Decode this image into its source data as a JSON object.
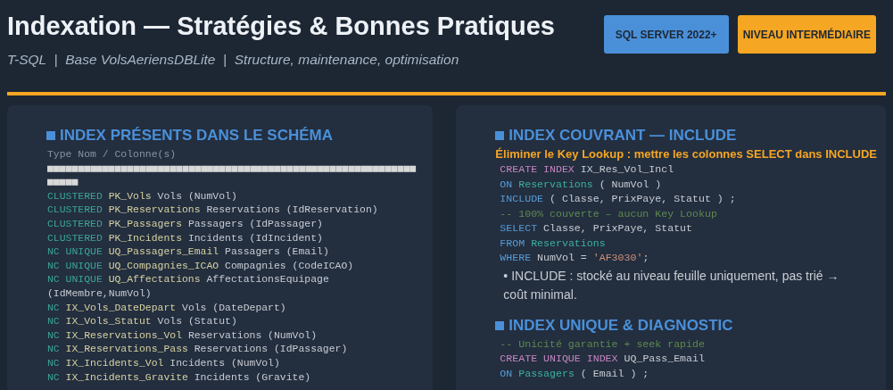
{
  "header": {
    "title": "Indexation — Stratégies & Bonnes Pratiques",
    "subtitle": "T-SQL  |  Base VolsAeriensDBLite  |  Structure, maintenance, optimisation",
    "badges": [
      {
        "label": "SQL SERVER 2022+",
        "color": "#4a90d9"
      },
      {
        "label": "NIVEAU INTERMÉDIAIRE",
        "color": "#f5a623"
      }
    ]
  },
  "cards": [
    {
      "blocks": [
        {
          "kind": "heading",
          "text": "INDEX PRÉSENTS DANS LE SCHÉMA"
        },
        {
          "kind": "caption",
          "text": "Type Nom / Colonne(s)"
        },
        {
          "kind": "rule",
          "text": "■■■■■■■■■■■■■■■■■■■■■■■■■■■■■■■■■■■■■■■■■■■■■■■■■■■■■■■■■■■■■■■■■"
        },
        {
          "kind": "code",
          "tokens": [
            {
              "kind": "type",
              "text": "CLUSTERED"
            },
            {
              "kind": "name",
              "text": " PK_Vols"
            },
            {
              "kind": "plain",
              "text": " Vols (NumVol)"
            }
          ]
        },
        {
          "kind": "code",
          "tokens": [
            {
              "kind": "type",
              "text": "CLUSTERED"
            },
            {
              "kind": "name",
              "text": " PK_Reservations"
            },
            {
              "kind": "plain",
              "text": " Reservations (IdReservation)"
            }
          ]
        },
        {
          "kind": "code",
          "tokens": [
            {
              "kind": "type",
              "text": "CLUSTERED"
            },
            {
              "kind": "name",
              "text": " PK_Passagers"
            },
            {
              "kind": "plain",
              "text": " Passagers (IdPassager)"
            }
          ]
        },
        {
          "kind": "code",
          "tokens": [
            {
              "kind": "type",
              "text": "CLUSTERED"
            },
            {
              "kind": "name",
              "text": " PK_Incidents"
            },
            {
              "kind": "plain",
              "text": " Incidents (IdIncident)"
            }
          ]
        },
        {
          "kind": "code",
          "tokens": [
            {
              "kind": "type",
              "text": "NC UNIQUE"
            },
            {
              "kind": "name",
              "text": " UQ_Passagers_Email"
            },
            {
              "kind": "plain",
              "text": " Passagers (Email)"
            }
          ]
        },
        {
          "kind": "code",
          "tokens": [
            {
              "kind": "type",
              "text": "NC UNIQUE"
            },
            {
              "kind": "name",
              "text": " UQ_Compagnies_ICAO"
            },
            {
              "kind": "plain",
              "text": " Compagnies (CodeICAO)"
            }
          ]
        },
        {
          "kind": "code",
          "tokens": [
            {
              "kind": "type",
              "text": "NC UNIQUE"
            },
            {
              "kind": "name",
              "text": " UQ_Affectations"
            },
            {
              "kind": "plain",
              "text": " AffectationsEquipage (IdMembre,NumVol)"
            }
          ]
        },
        {
          "kind": "code",
          "tokens": [
            {
              "kind": "type",
              "text": "NC"
            },
            {
              "kind": "name",
              "text": " IX_Vols_DateDepart"
            },
            {
              "kind": "plain",
              "text": " Vols (DateDepart)"
            }
          ]
        },
        {
          "kind": "code",
          "tokens": [
            {
              "kind": "type",
              "text": "NC"
            },
            {
              "kind": "name",
              "text": " IX_Vols_Statut"
            },
            {
              "kind": "plain",
              "text": " Vols (Statut)"
            }
          ]
        },
        {
          "kind": "code",
          "tokens": [
            {
              "kind": "type",
              "text": "NC"
            },
            {
              "kind": "name",
              "text": " IX_Reservations_Vol"
            },
            {
              "kind": "plain",
              "text": " Reservations (NumVol)"
            }
          ]
        },
        {
          "kind": "code",
          "tokens": [
            {
              "kind": "type",
              "text": "NC"
            },
            {
              "kind": "name",
              "text": " IX_Reservations_Pass"
            },
            {
              "kind": "plain",
              "text": " Reservations (IdPassager)"
            }
          ]
        },
        {
          "kind": "code",
          "tokens": [
            {
              "kind": "type",
              "text": "NC"
            },
            {
              "kind": "name",
              "text": " IX_Incidents_Vol"
            },
            {
              "kind": "plain",
              "text": " Incidents (NumVol)"
            }
          ]
        },
        {
          "kind": "code",
          "tokens": [
            {
              "kind": "type",
              "text": "NC"
            },
            {
              "kind": "name",
              "text": " IX_Incidents_Gravite"
            },
            {
              "kind": "plain",
              "text": " Incidents (Gravite)"
            }
          ]
        }
      ]
    },
    {
      "blocks": [
        {
          "kind": "heading",
          "text": "INDEX COUVRANT — INCLUDE"
        },
        {
          "kind": "note",
          "text": "Éliminer le Key Lookup : mettre les colonnes SELECT dans INCLUDE"
        },
        {
          "kind": "code",
          "tokens": [
            {
              "kind": "ddl",
              "text": "CREATE INDEX"
            },
            {
              "kind": "plain",
              "text": " IX_Res_Vol_Incl"
            }
          ]
        },
        {
          "kind": "code",
          "tokens": [
            {
              "kind": "keyword",
              "text": "ON"
            },
            {
              "kind": "table",
              "text": " Reservations"
            },
            {
              "kind": "plain",
              "text": " ( NumVol )"
            }
          ]
        },
        {
          "kind": "code",
          "tokens": [
            {
              "kind": "keyword",
              "text": "INCLUDE"
            },
            {
              "kind": "plain",
              "text": " ( Classe, PrixPaye, Statut ) ;"
            }
          ]
        },
        {
          "kind": "code",
          "tokens": [
            {
              "kind": "comment",
              "text": "-- 100% couverte – aucun Key Lookup"
            }
          ]
        },
        {
          "kind": "code",
          "tokens": [
            {
              "kind": "keyword",
              "text": "SELECT"
            },
            {
              "kind": "plain",
              "text": " Classe, PrixPaye, Statut"
            }
          ]
        },
        {
          "kind": "code",
          "tokens": [
            {
              "kind": "keyword",
              "text": "FROM"
            },
            {
              "kind": "table",
              "text": " Reservations"
            }
          ]
        },
        {
          "kind": "code",
          "tokens": [
            {
              "kind": "keyword",
              "text": "WHERE"
            },
            {
              "kind": "plain",
              "text": " NumVol = "
            },
            {
              "kind": "string",
              "text": "'AF3030'"
            },
            {
              "kind": "plain",
              "text": ";"
            }
          ]
        },
        {
          "kind": "bullet",
          "text": "• INCLUDE : stocké au niveau feuille uniquement, pas trié → coût minimal."
        },
        {
          "kind": "heading",
          "text": "INDEX UNIQUE & DIAGNOSTIC"
        },
        {
          "kind": "code",
          "tokens": [
            {
              "kind": "comment",
              "text": "-- Unicité garantie + seek rapide"
            }
          ]
        },
        {
          "kind": "code",
          "tokens": [
            {
              "kind": "ddl",
              "text": "CREATE UNIQUE INDEX"
            },
            {
              "kind": "plain",
              "text": " UQ_Pass_Email"
            }
          ]
        },
        {
          "kind": "code",
          "tokens": [
            {
              "kind": "keyword",
              "text": "ON"
            },
            {
              "kind": "table",
              "text": " Passagers"
            },
            {
              "kind": "plain",
              "text": " ( Email ) ;"
            }
          ]
        }
      ]
    }
  ]
}
